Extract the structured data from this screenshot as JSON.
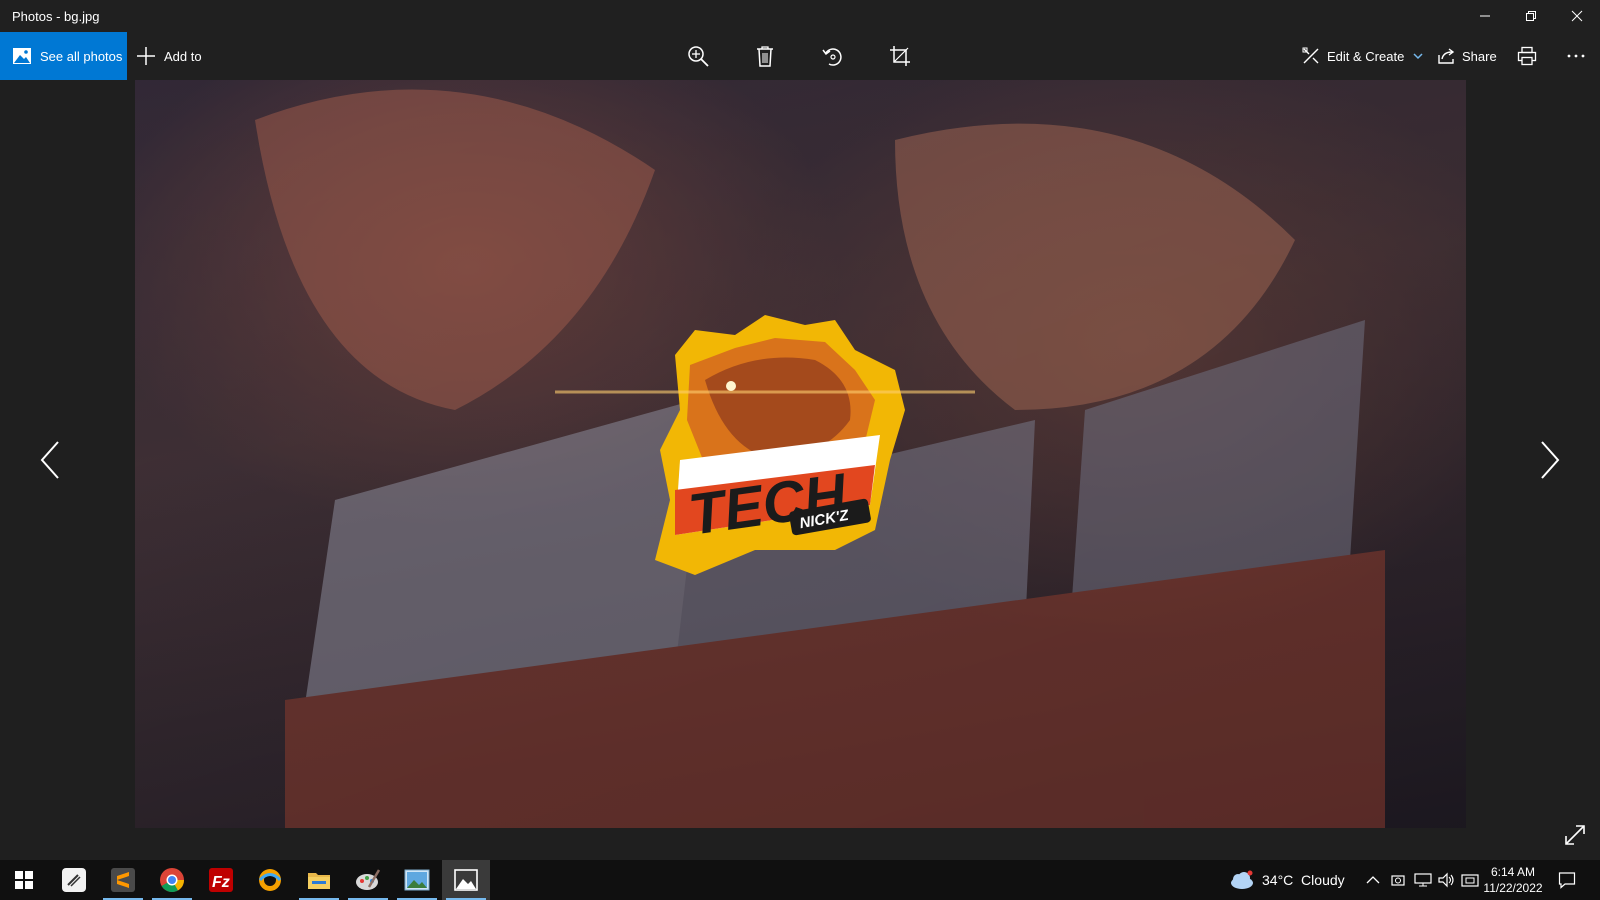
{
  "window": {
    "title": "Photos - bg.jpg",
    "controls": [
      "minimize-icon",
      "restore-icon",
      "close-icon"
    ]
  },
  "toolbar": {
    "see_all_label": "See all photos",
    "add_to_label": "Add to",
    "center_tools": [
      "zoom-in-icon",
      "delete-icon",
      "rotate-icon",
      "crop-icon"
    ],
    "edit_create_label": "Edit & Create",
    "share_label": "Share",
    "accent": "#0078d4"
  },
  "photo": {
    "logo_text": "TECH",
    "logo_subtext": "NICK'Z"
  },
  "taskbar": {
    "apps": [
      "start-icon",
      "notes-app-icon",
      "sublime-text-icon",
      "chrome-icon",
      "filezilla-icon",
      "browser-icon",
      "file-explorer-icon",
      "paint-icon",
      "photo-viewer-icon",
      "photos-app-icon"
    ],
    "weather": "34°C  Cloudy",
    "time": "6:14 AM",
    "date": "11/22/2022"
  }
}
